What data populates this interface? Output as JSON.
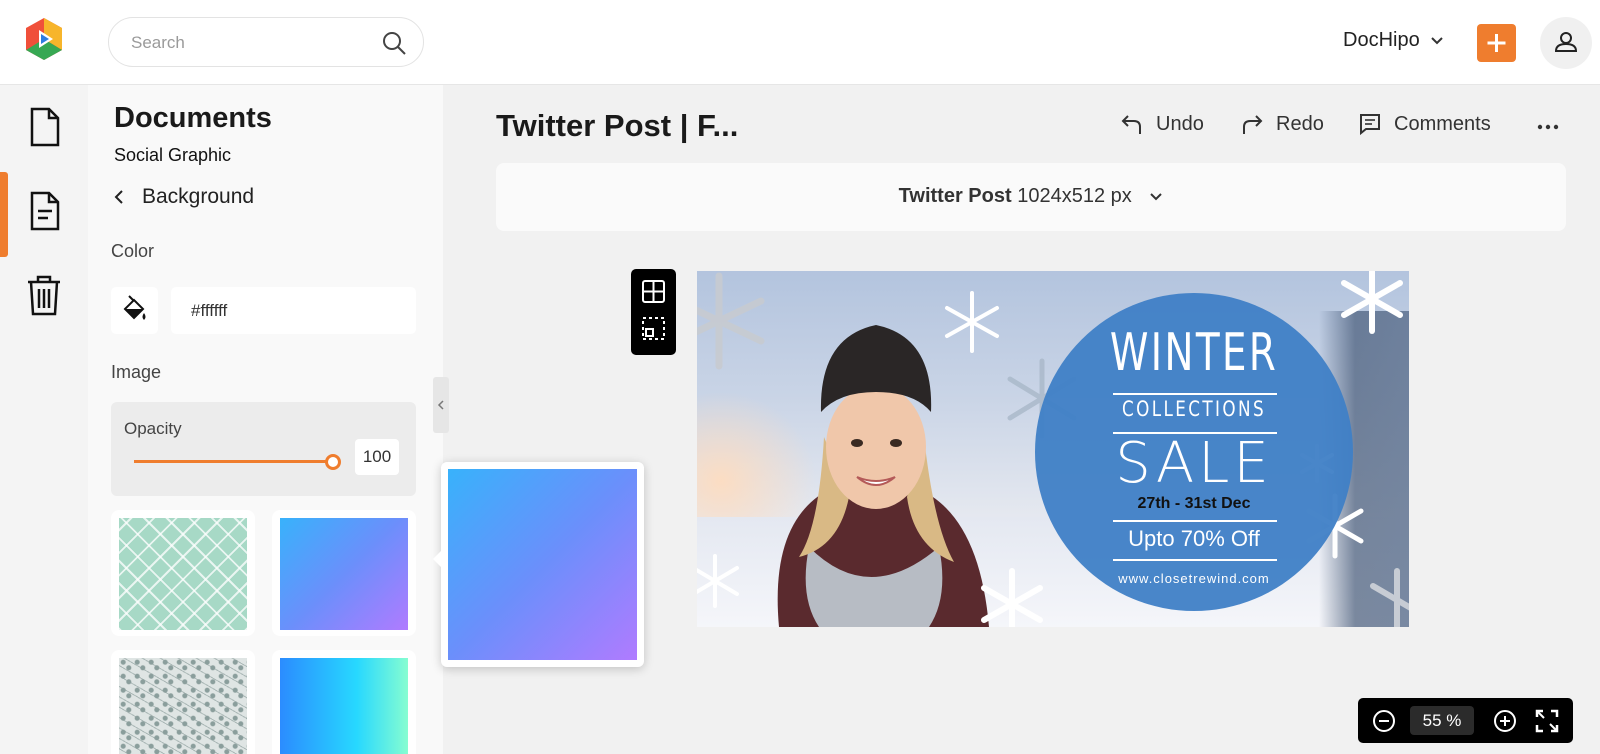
{
  "brand": {
    "accent": "#ef7d2e",
    "logo": "dochipo-logo"
  },
  "search": {
    "placeholder": "Search",
    "icon": "search-icon"
  },
  "header": {
    "workspace": "DocHipo",
    "plus_icon": "plus-icon",
    "profile_icon": "user-icon"
  },
  "rail": {
    "items": [
      "documents-icon",
      "templates-icon",
      "trash-icon"
    ],
    "active": 1
  },
  "panel": {
    "title": "Documents",
    "subtitle": "Social Graphic",
    "back_label": "Background",
    "color_label": "Color",
    "color_value": "#ffffff",
    "image_label": "Image",
    "opacity_label": "Opacity",
    "opacity_value": "100",
    "thumbnails": [
      "green-lattice-pattern",
      "blue-purple-gradient",
      "gray-damask-pattern",
      "cyan-gradient"
    ]
  },
  "main": {
    "title": "Twitter Post | F...",
    "undo": "Undo",
    "redo": "Redo",
    "comments": "Comments",
    "size_name": "Twitter Post",
    "size_dims": "1024x512 px"
  },
  "banner": {
    "headline": "WINTER",
    "collections": "COLLECTIONS",
    "sale": "SALE",
    "dates": "27th - 31st Dec",
    "offer": "Upto 70% Off",
    "url": "www.closetrewind.com",
    "circle_color": "#3f7fc6"
  },
  "zoom": {
    "value": "55",
    "unit": "%"
  }
}
